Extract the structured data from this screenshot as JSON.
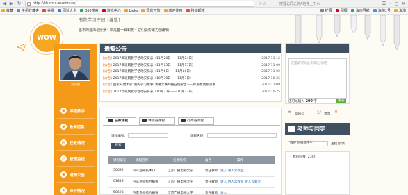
{
  "browser": {
    "back": "◀",
    "forward": "▶",
    "refresh": "↻",
    "url": "http://thome.ouchn.cn/",
    "star": "☆",
    "bookmark_icon": "⚡",
    "tab_title": "搜狸北同之称A站搬上下水",
    "controls": [
      "☰",
      "─",
      "□",
      "✕"
    ],
    "bookmarks": [
      {
        "label": "收藏",
        "color": "#f0b400"
      },
      {
        "label": "手机收藏夹",
        "color": "#4a90e2"
      },
      {
        "label": "谷歌",
        "color": "#dd4b39"
      },
      {
        "label": "网址大全",
        "color": "#3b7ddd"
      },
      {
        "label": "360搜索",
        "color": "#2fa84f"
      },
      {
        "label": "游戏中心",
        "color": "#d0021b"
      },
      {
        "label": "Links",
        "color": "#f5a623"
      },
      {
        "label": "国家开放",
        "color": "#f5a623"
      },
      {
        "label": "欢迎使用",
        "color": "#f5a623"
      },
      {
        "label": "移动邮箱",
        "color": "#e74c3c"
      }
    ],
    "bookmarks_right": [
      {
        "label": "扩展",
        "color": "#7b8794"
      },
      {
        "label": "网银",
        "color": "#d0021b"
      },
      {
        "label": "海南导航",
        "color": "#2fa84f"
      },
      {
        "label": "海淘1号",
        "color": "#4a90e2"
      },
      {
        "label": "海淘",
        "color": "#f5a623"
      }
    ]
  },
  "header": {
    "school_title": "书院学习空间 [编辑]",
    "motto": "当下的自由与愿景：新是备一种积攻：它们会影聚力创编辑"
  },
  "badge": "WOW",
  "user": {
    "name": "刘晓燕"
  },
  "menu": [
    {
      "label": "课程教学",
      "icon": "▣"
    },
    {
      "label": "教务团队",
      "icon": "◉"
    },
    {
      "label": "任教情况",
      "icon": "▤"
    },
    {
      "label": "管理监控",
      "icon": "◎"
    },
    {
      "label": "通知公告",
      "icon": "◆"
    },
    {
      "label": "评价情况",
      "icon": "★"
    }
  ],
  "notice": {
    "title": "通知公告",
    "more": "更多",
    "items": [
      {
        "tag": "[公告]",
        "text": "2017年班网教学活动安排表（11月20日——11月24日）",
        "date": "2017-11-16"
      },
      {
        "tag": "[公告]",
        "text": "2017年班网教学活动安排表（11月13日——11月17日）",
        "date": "2017-11-09"
      },
      {
        "tag": "[公告]",
        "text": "2017年班网教学活动安排表（11月6日——11月10日）",
        "date": "2017-11-02"
      },
      {
        "tag": "[公告]",
        "text": "2017年班网教学活动安排表（10月30日——11月3日）",
        "date": "2017-10-26"
      },
      {
        "tag": "[公告]",
        "text": "国家开放大学“我的学习故事”演讲大赛网络在线报告——即用教我系演讲",
        "date": "2017-11-09"
      },
      {
        "tag": "[公告]",
        "text": "2017年班网教学活动安排表（10月23日——10月27日）",
        "date": "2017-10-25"
      }
    ]
  },
  "post_box": {
    "placeholder": "这里填写你此刻的心情吧",
    "count_label": "还可以输入",
    "count": "200",
    "unit": "字",
    "submit": "发表"
  },
  "social": {
    "activity": "动内信",
    "messages": "消息",
    "badge": "0"
  },
  "teacher_panel": {
    "title": "老师与同学",
    "search_value": "教授  同事与学生",
    "search_link": "查找 反馈",
    "block_item": "◦ 我的同事 (230)"
  },
  "course": {
    "tabs": [
      "任教课程",
      "课程班课程",
      "行政班课程"
    ],
    "code_label": "课程编号：",
    "name_label": "课程名称：",
    "search_button": "搜索",
    "columns": [
      "课程编号",
      "课程名称",
      "任教机构",
      "角色",
      "操作"
    ],
    "rows": [
      {
        "code": "50692",
        "name": "汽车运输技术(A)",
        "org": "江苏广播电视大学",
        "role": "责任教师",
        "ops": "进入  进入云教室"
      },
      {
        "code": "03849",
        "name": "汽车专业综合概要",
        "org": "江苏广播电视大学",
        "role": "责任教师",
        "ops": "进入  进入云教室  进入云教室"
      },
      {
        "code": "50693",
        "name": "汽车专业综合概要",
        "org": "江苏广播电视大学",
        "role": "责任教师",
        "ops": "进入"
      }
    ]
  }
}
